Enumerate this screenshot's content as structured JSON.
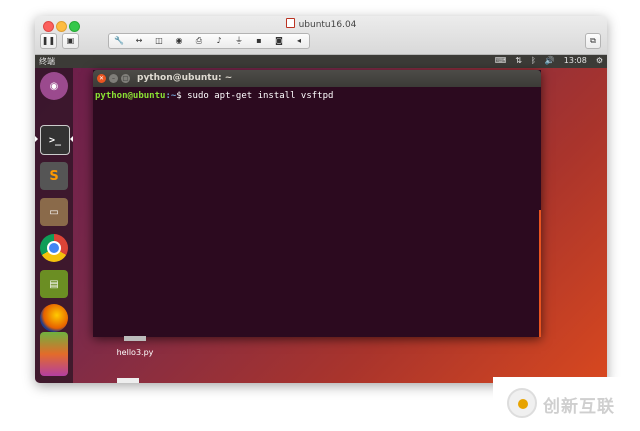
{
  "window": {
    "title": "ubuntu16.04",
    "toolbar": {
      "pause_icon": "pause-icon",
      "snapshot_icon": "snapshot-icon",
      "group_icons": [
        "wrench-icon",
        "arrows-icon",
        "disk-icon",
        "lock-icon",
        "printer-icon",
        "speaker-icon",
        "usb-icon",
        "save-icon",
        "camera-icon",
        "chevron-left-icon"
      ],
      "fullscreen_icon": "fullscreen-icon"
    }
  },
  "ubuntu": {
    "topbar": {
      "app_name": "终端",
      "time": "13:08",
      "status_icons": [
        "keyboard-icon",
        "network-icon",
        "bluetooth-icon",
        "volume-icon",
        "gear-icon"
      ]
    },
    "launcher": [
      "ubuntu-dash-icon",
      "terminal-icon",
      "sublime-text-icon",
      "file-manager-icon",
      "chrome-icon",
      "archive-icon",
      "firefox-icon",
      "libreoffice-icon"
    ],
    "terminal": {
      "title": "python@ubuntu: ~",
      "prompt_user": "python@ubuntu",
      "prompt_path": ":~",
      "prompt_symbol": "$",
      "command": " sudo apt-get install vsftpd"
    },
    "desktop": {
      "file_name": "hello3.py"
    }
  },
  "watermark": {
    "text": "创新互联"
  },
  "colors": {
    "ubuntu_orange": "#e95420",
    "terminal_bg": "#2c0a1f",
    "prompt_green": "#8ae234",
    "prompt_blue": "#729fcf"
  }
}
